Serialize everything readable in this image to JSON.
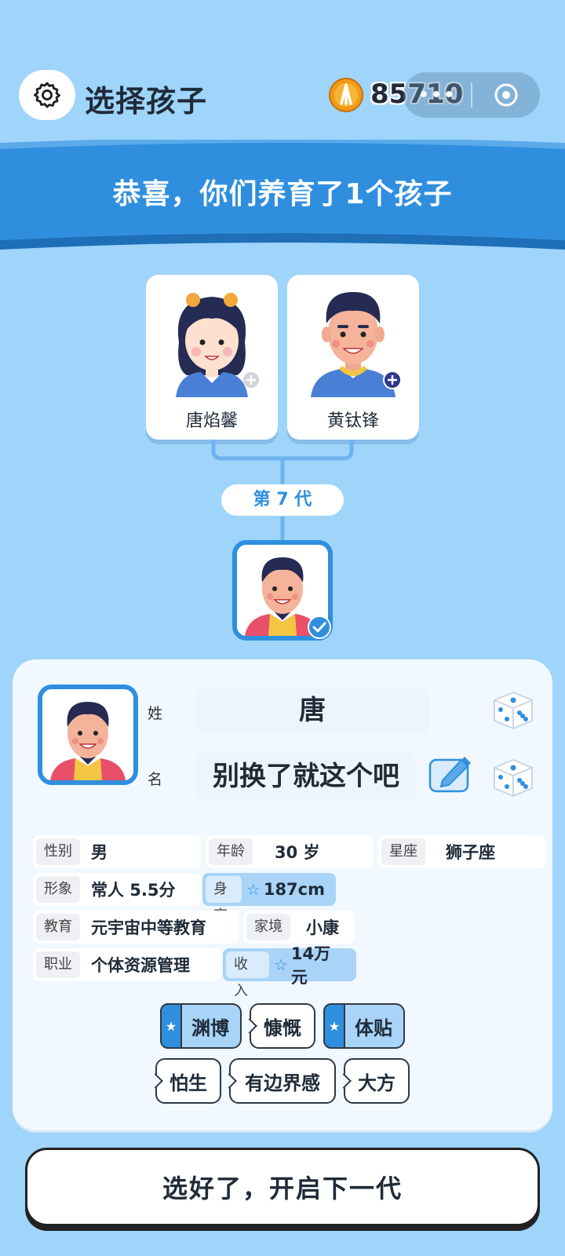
{
  "header": {
    "title": "选择孩子",
    "coins": "85710",
    "capsule_more": "•••"
  },
  "banner": {
    "message": "恭喜，你们养育了1个孩子"
  },
  "parents": [
    {
      "name": "唐焰馨"
    },
    {
      "name": "黄钛锋"
    }
  ],
  "generation": "第 7 代",
  "child": {
    "surname_label": "姓",
    "surname": "唐",
    "given_label": "名",
    "given_name": "别换了就这个吧",
    "attributes": [
      {
        "key": "性别",
        "value": "男"
      },
      {
        "key": "年龄",
        "value": "30 岁"
      },
      {
        "key": "星座",
        "value": "狮子座"
      },
      {
        "key": "形象",
        "value": "常人 5.5分"
      },
      {
        "key": "身高",
        "value": "187cm",
        "starred": true
      },
      {
        "key": "教育",
        "value": "元宇宙中等教育"
      },
      {
        "key": "家境",
        "value": "小康"
      },
      {
        "key": "职业",
        "value": "个体资源管理"
      },
      {
        "key": "收入",
        "value": "14万元",
        "starred": true
      }
    ],
    "traits": [
      {
        "label": "渊博",
        "starred": true
      },
      {
        "label": "慷慨",
        "starred": false
      },
      {
        "label": "体贴",
        "starred": true
      },
      {
        "label": "怕生",
        "starred": false
      },
      {
        "label": "有边界感",
        "starred": false
      },
      {
        "label": "大方",
        "starred": false
      }
    ]
  },
  "confirm_button": "选好了，开启下一代",
  "colors": {
    "background": "#9fd4fb",
    "accent_blue": "#2f8fde",
    "highlight_blue": "#a9d4f8",
    "coin_orange": "#f39a1a"
  }
}
